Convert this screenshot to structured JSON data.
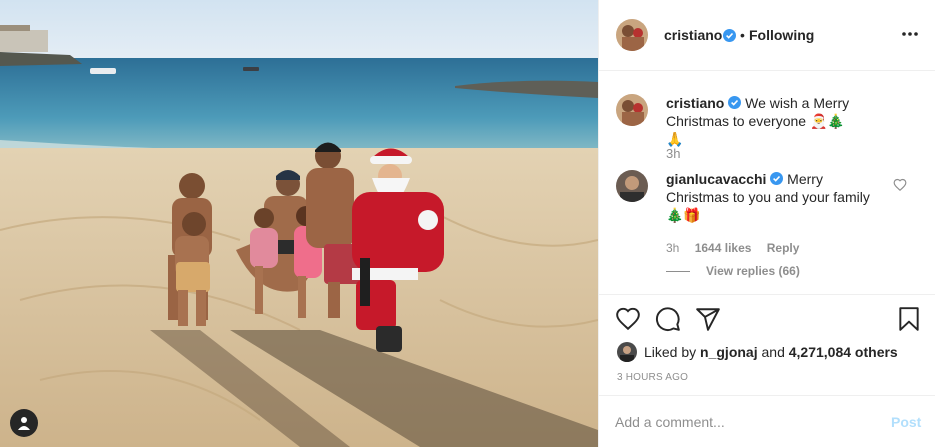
{
  "post": {
    "author": {
      "username": "cristiano",
      "verified": true
    },
    "follow_state": "Following",
    "header_separator": "•"
  },
  "comments": [
    {
      "username": "cristiano",
      "verified": true,
      "text": "We wish a Merry Christmas to everyone 🎅🎄🙏",
      "time": "3h"
    },
    {
      "username": "gianlucavacchi",
      "verified": true,
      "text": "Merry Christmas to you and your family 🎄🎁",
      "time": "3h",
      "likes": "1644 likes",
      "reply_label": "Reply",
      "view_replies": "View replies (66)"
    }
  ],
  "likes": {
    "prefix": "Liked by",
    "user": "n_gjonaj",
    "middle": "and",
    "count": "4,271,084 others"
  },
  "timestamp": "3 HOURS AGO",
  "comment_box": {
    "placeholder": "Add a comment...",
    "post_label": "Post"
  },
  "colors": {
    "verified": "#3897f0",
    "border": "#efefef",
    "muted": "#8e8e8e",
    "post_disabled": "#b2dffc",
    "sea": "#3f8fb0",
    "sand": "#d8c4a3",
    "sky": "#a9cbe6"
  },
  "icons": [
    "tag-user-icon",
    "verified-icon",
    "more-icon",
    "heart-icon",
    "comment-icon",
    "share-icon",
    "bookmark-icon"
  ]
}
